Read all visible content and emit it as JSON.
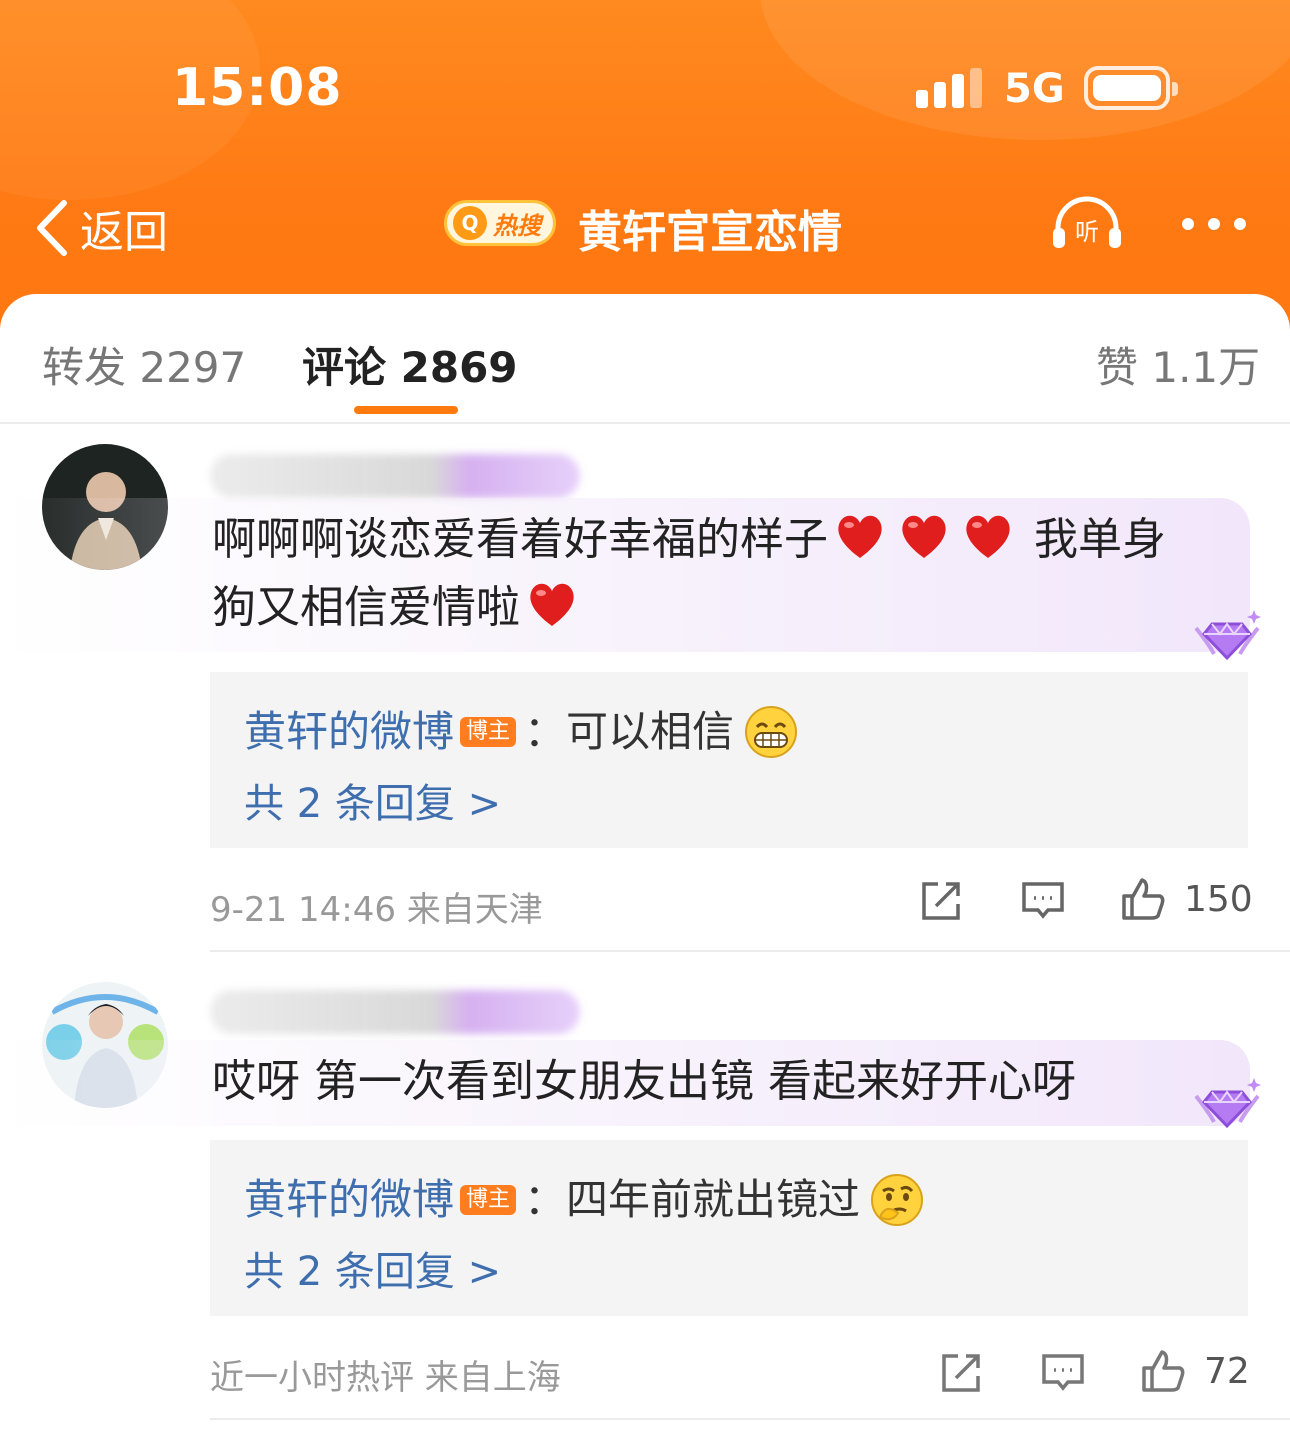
{
  "status_bar": {
    "time": "15:08",
    "network": "5G"
  },
  "nav": {
    "back_label": "返回",
    "hot_label": "热搜",
    "title": "黄轩官宣恋情",
    "listen_label": "听"
  },
  "tabs": [
    {
      "label": "转发 2297"
    },
    {
      "label": "评论 2869"
    },
    {
      "label": "赞 1.1万"
    }
  ],
  "comments": [
    {
      "text": "啊啊啊谈恋爱看着好幸福的样子",
      "text_tail_1": "我单身狗又相信爱情啦",
      "reply_author": "黄轩的微博",
      "blogger_tag": "博主",
      "reply_text": "可以相信",
      "reply_count": "共 2 条回复 >",
      "meta": "9-21 14:46  来自天津",
      "likes": "150"
    },
    {
      "text": "哎呀 第一次看到女朋友出镜 看起来好开心呀",
      "reply_author": "黄轩的微博",
      "blogger_tag": "博主",
      "reply_text": "四年前就出镜过",
      "reply_count": "共 2 条回复 >",
      "meta": "近一小时热评  来自上海",
      "likes": "72"
    }
  ],
  "colors": {
    "header": "#ff7a14",
    "accent": "#ff7a0c",
    "link": "#3e6eae",
    "blogger_tag": "#ff7d1e"
  }
}
